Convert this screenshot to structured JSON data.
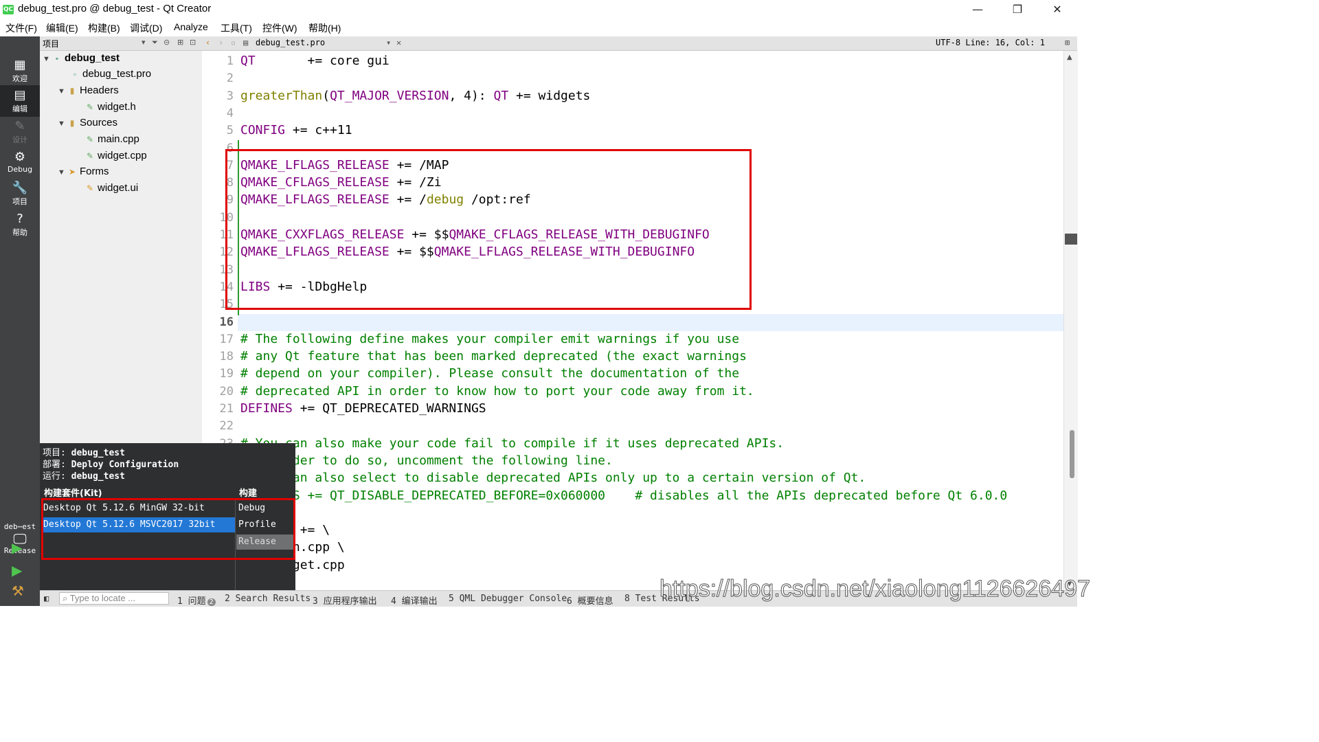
{
  "window": {
    "title": "debug_test.pro @ debug_test - Qt Creator",
    "app_icon": "QC",
    "minimize": "—",
    "maximize": "❐",
    "close": "✕"
  },
  "menu": [
    "文件(F)",
    "编辑(E)",
    "构建(B)",
    "调试(D)",
    "Analyze",
    "工具(T)",
    "控件(W)",
    "帮助(H)"
  ],
  "modes": [
    {
      "label": "欢迎",
      "icon": "▦"
    },
    {
      "label": "编辑",
      "icon": "▤"
    },
    {
      "label": "设计",
      "icon": "✎"
    },
    {
      "label": "Debug",
      "icon": "⚙"
    },
    {
      "label": "项目",
      "icon": "🔧"
    },
    {
      "label": "帮助",
      "icon": "?"
    }
  ],
  "project_panel": {
    "header": "项目",
    "tree": [
      {
        "label": "debug_test",
        "bold": true
      },
      {
        "label": "debug_test.pro"
      },
      {
        "label": "Headers"
      },
      {
        "label": "widget.h"
      },
      {
        "label": "Sources"
      },
      {
        "label": "main.cpp"
      },
      {
        "label": "widget.cpp"
      },
      {
        "label": "Forms"
      },
      {
        "label": "widget.ui"
      }
    ]
  },
  "editor_toolbar": {
    "file": "debug_test.pro",
    "status": "UTF-8 Line: 16, Col: 1"
  },
  "code_lines": [
    "QT       += core gui",
    "",
    "greaterThan(QT_MAJOR_VERSION, 4): QT += widgets",
    "",
    "CONFIG += c++11",
    "",
    "QMAKE_LFLAGS_RELEASE += /MAP",
    "QMAKE_CFLAGS_RELEASE += /Zi",
    "QMAKE_LFLAGS_RELEASE += /debug /opt:ref",
    "",
    "QMAKE_CXXFLAGS_RELEASE += $$QMAKE_CFLAGS_RELEASE_WITH_DEBUGINFO",
    "QMAKE_LFLAGS_RELEASE += $$QMAKE_LFLAGS_RELEASE_WITH_DEBUGINFO",
    "",
    "LIBS += -lDbgHelp",
    "",
    "",
    "# The following define makes your compiler emit warnings if you use",
    "# any Qt feature that has been marked deprecated (the exact warnings",
    "# depend on your compiler). Please consult the documentation of the",
    "# deprecated API in order to know how to port your code away from it.",
    "DEFINES += QT_DEPRECATED_WARNINGS",
    "",
    "# You can also make your code fail to compile if it uses deprecated APIs.",
    "# In order to do so, uncomment the following line.",
    "# You can also select to disable deprecated APIs only up to a certain version of Qt.",
    "#DEFINES += QT_DISABLE_DEPRECATED_BEFORE=0x060000    # disables all the APIs deprecated before Qt 6.0.0",
    "",
    "SOURCES += \\",
    "    main.cpp \\",
    "    widget.cpp"
  ],
  "current_line": 16,
  "kit_popup": {
    "project_label": "项目:",
    "project": "debug_test",
    "deploy_label": "部署:",
    "deploy": "Deploy Configuration",
    "run_label": "运行:",
    "run": "debug_test",
    "kit_header": "构建套件(Kit)",
    "build_header": "构建",
    "kits": [
      "Desktop Qt 5.12.6 MinGW 32-bit",
      "Desktop Qt 5.12.6 MSVC2017 32bit"
    ],
    "selected_kit": 1,
    "builds": [
      "Debug",
      "Profile",
      "Release"
    ],
    "selected_build": 2
  },
  "selector": {
    "project": "deb⋯est",
    "build": "Release"
  },
  "statusbar": {
    "locate_placeholder": "Type to locate ...",
    "tabs": [
      "1 问题",
      "2 Search Results",
      "3 应用程序输出",
      "4 编译输出",
      "5 QML Debugger Console",
      "6 概要信息",
      "8 Test Results"
    ],
    "issues_count": "2"
  },
  "watermark": "https://blog.csdn.net/xiaolong1126626497",
  "colors": {
    "highlight": "#e00000",
    "keyword": "#800080",
    "function": "#808000",
    "comment": "#008000",
    "selection": "#2378d6"
  }
}
